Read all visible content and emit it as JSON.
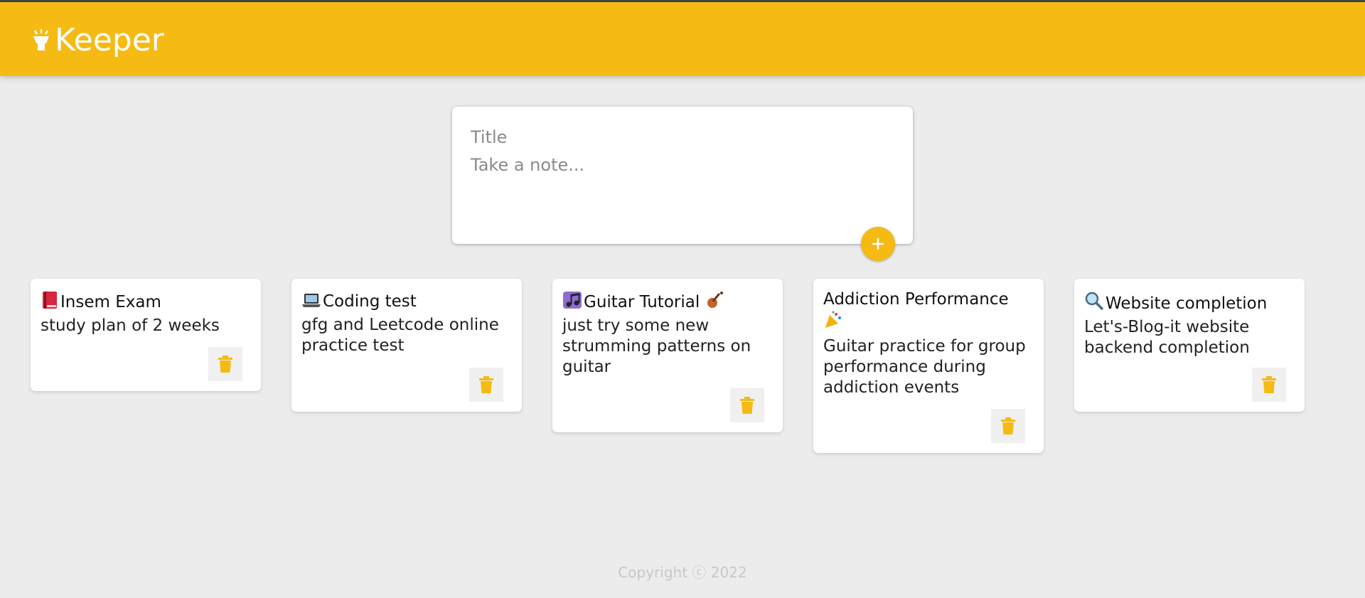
{
  "app": {
    "title": "Keeper"
  },
  "create_form": {
    "title_placeholder": "Title",
    "content_placeholder": "Take a note...",
    "add_label": "+"
  },
  "notes": [
    {
      "emoji": "book-icon",
      "title": "Insem Exam",
      "content": "study plan of 2 weeks"
    },
    {
      "emoji": "laptop-icon",
      "title": "Coding test",
      "content": "gfg and Leetcode online practice test"
    },
    {
      "emoji": "music-icon",
      "title": "Guitar Tutorial",
      "emoji_after": "violin-icon",
      "content": "just try some new strumming patterns on guitar"
    },
    {
      "title": "Addiction Performance",
      "emoji_after": "party-popper-icon",
      "content": "Guitar practice for group performance during addiction events"
    },
    {
      "emoji": "magnifier-icon",
      "title": "Website completion",
      "content": "Let's-Blog-it website backend completion"
    }
  ],
  "footer": {
    "text": "Copyright ⓒ 2022"
  },
  "colors": {
    "accent": "#f5ba13",
    "background": "#ececec"
  }
}
